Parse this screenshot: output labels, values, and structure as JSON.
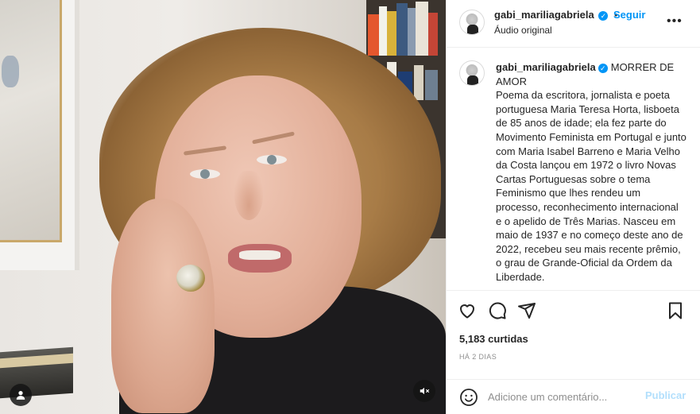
{
  "colors": {
    "accent": "#0095f6",
    "accent_disabled": "#b2dffc",
    "text": "#262626",
    "muted": "#8e8e8e",
    "divider": "#efefef"
  },
  "media": {
    "user_tag_icon": "person-icon",
    "mute_icon": "speaker-muted-icon"
  },
  "header": {
    "username": "gabi_mariliagabriela",
    "separator": "•",
    "follow_label": "Seguir",
    "audio_label": "Áudio original",
    "more_label": "•••"
  },
  "caption": {
    "username": "gabi_mariliagabriela",
    "text": "MORRER DE AMOR\nPoema da escritora, jornalista e poeta portuguesa Maria Teresa Horta, lisboeta de 85 anos de idade; ela fez parte do Movimento Feminista em Portugal e junto com Maria Isabel Barreno e Maria Velho da Costa lançou em 1972 o livro Novas Cartas Portuguesas sobre o tema Feminismo que lhes rendeu um processo, reconhecimento internacional e o apelido de Três Marias. Nasceu em maio de 1937 e no começo deste ano de 2022, recebeu seu mais recente prêmio, o grau de Grande-Oficial da Ordem da Liberdade."
  },
  "actions": {
    "like_icon": "heart-icon",
    "comment_icon": "speech-bubble-icon",
    "share_icon": "paper-plane-icon",
    "save_icon": "bookmark-icon",
    "likes_text": "5,183 curtidas",
    "time_ago": "HÁ 2 DIAS"
  },
  "comment_box": {
    "placeholder": "Adicione um comentário...",
    "post_label": "Publicar"
  }
}
